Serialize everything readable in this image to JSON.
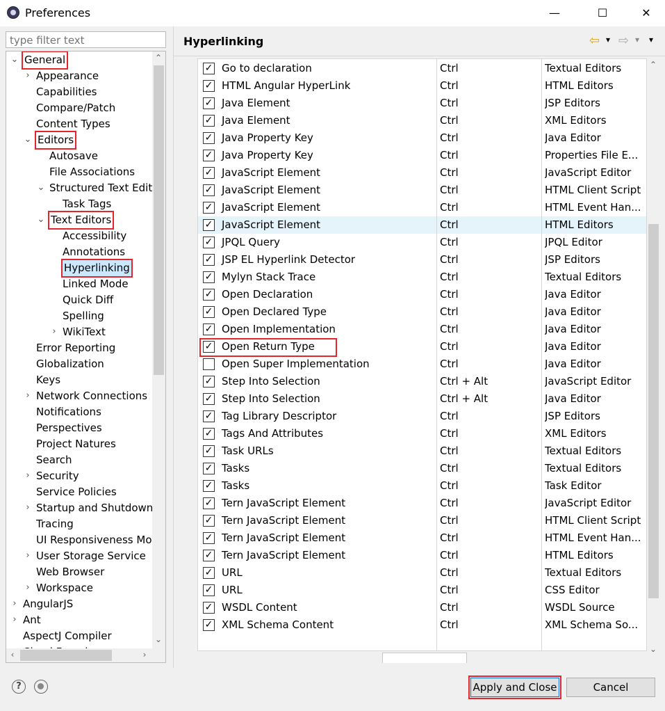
{
  "window": {
    "title": "Preferences",
    "minimize": "—",
    "maximize": "☐",
    "close": "✕"
  },
  "filter": {
    "placeholder": "type filter text"
  },
  "tree": [
    {
      "label": "General",
      "level": 0,
      "twisty": "open",
      "highlight": true
    },
    {
      "label": "Appearance",
      "level": 1,
      "twisty": "closed"
    },
    {
      "label": "Capabilities",
      "level": 1
    },
    {
      "label": "Compare/Patch",
      "level": 1
    },
    {
      "label": "Content Types",
      "level": 1
    },
    {
      "label": "Editors",
      "level": 1,
      "twisty": "open",
      "highlight": true
    },
    {
      "label": "Autosave",
      "level": 2
    },
    {
      "label": "File Associations",
      "level": 2
    },
    {
      "label": "Structured Text Editors",
      "level": 2,
      "twisty": "open"
    },
    {
      "label": "Task Tags",
      "level": 3
    },
    {
      "label": "Text Editors",
      "level": 2,
      "twisty": "open",
      "highlight": true
    },
    {
      "label": "Accessibility",
      "level": 3
    },
    {
      "label": "Annotations",
      "level": 3
    },
    {
      "label": "Hyperlinking",
      "level": 3,
      "highlight": true,
      "selected": true
    },
    {
      "label": "Linked Mode",
      "level": 3
    },
    {
      "label": "Quick Diff",
      "level": 3
    },
    {
      "label": "Spelling",
      "level": 3
    },
    {
      "label": "WikiText",
      "level": 3,
      "twisty": "closed"
    },
    {
      "label": "Error Reporting",
      "level": 1
    },
    {
      "label": "Globalization",
      "level": 1
    },
    {
      "label": "Keys",
      "level": 1
    },
    {
      "label": "Network Connections",
      "level": 1,
      "twisty": "closed"
    },
    {
      "label": "Notifications",
      "level": 1
    },
    {
      "label": "Perspectives",
      "level": 1
    },
    {
      "label": "Project Natures",
      "level": 1
    },
    {
      "label": "Search",
      "level": 1
    },
    {
      "label": "Security",
      "level": 1,
      "twisty": "closed"
    },
    {
      "label": "Service Policies",
      "level": 1
    },
    {
      "label": "Startup and Shutdown",
      "level": 1,
      "twisty": "closed"
    },
    {
      "label": "Tracing",
      "level": 1
    },
    {
      "label": "UI Responsiveness Monitoring",
      "level": 1
    },
    {
      "label": "User Storage Service",
      "level": 1,
      "twisty": "closed"
    },
    {
      "label": "Web Browser",
      "level": 1
    },
    {
      "label": "Workspace",
      "level": 1,
      "twisty": "closed"
    },
    {
      "label": "AngularJS",
      "level": 0,
      "twisty": "closed"
    },
    {
      "label": "Ant",
      "level": 0,
      "twisty": "closed"
    },
    {
      "label": "AspectJ Compiler",
      "level": 0
    },
    {
      "label": "Cloud Foundry",
      "level": 0,
      "twisty": "closed"
    }
  ],
  "page": {
    "title": "Hyperlinking"
  },
  "detectors": [
    {
      "name": "Go to declaration",
      "modifier": "Ctrl",
      "target": "Textual Editors",
      "checked": true
    },
    {
      "name": "HTML Angular HyperLink",
      "modifier": "Ctrl",
      "target": "HTML Editors",
      "checked": true
    },
    {
      "name": "Java Element",
      "modifier": "Ctrl",
      "target": "JSP Editors",
      "checked": true
    },
    {
      "name": "Java Element",
      "modifier": "Ctrl",
      "target": "XML Editors",
      "checked": true
    },
    {
      "name": "Java Property Key",
      "modifier": "Ctrl",
      "target": "Java Editor",
      "checked": true
    },
    {
      "name": "Java Property Key",
      "modifier": "Ctrl",
      "target": "Properties File E...",
      "checked": true
    },
    {
      "name": "JavaScript Element",
      "modifier": "Ctrl",
      "target": "JavaScript Editor",
      "checked": true
    },
    {
      "name": "JavaScript Element",
      "modifier": "Ctrl",
      "target": "HTML Client Script",
      "checked": true
    },
    {
      "name": "JavaScript Element",
      "modifier": "Ctrl",
      "target": "HTML Event Han...",
      "checked": true
    },
    {
      "name": "JavaScript Element",
      "modifier": "Ctrl",
      "target": "HTML Editors",
      "checked": true,
      "hover": true
    },
    {
      "name": "JPQL Query",
      "modifier": "Ctrl",
      "target": "JPQL Editor",
      "checked": true
    },
    {
      "name": "JSP EL Hyperlink Detector",
      "modifier": "Ctrl",
      "target": "JSP Editors",
      "checked": true
    },
    {
      "name": "Mylyn Stack Trace",
      "modifier": "Ctrl",
      "target": "Textual Editors",
      "checked": true
    },
    {
      "name": "Open Declaration",
      "modifier": "Ctrl",
      "target": "Java Editor",
      "checked": true
    },
    {
      "name": "Open Declared Type",
      "modifier": "Ctrl",
      "target": "Java Editor",
      "checked": true
    },
    {
      "name": "Open Implementation",
      "modifier": "Ctrl",
      "target": "Java Editor",
      "checked": true
    },
    {
      "name": "Open Return Type",
      "modifier": "Ctrl",
      "target": "Java Editor",
      "checked": true,
      "highlight": true
    },
    {
      "name": "Open Super Implementation",
      "modifier": "Ctrl",
      "target": "Java Editor",
      "checked": false
    },
    {
      "name": "Step Into Selection",
      "modifier": "Ctrl + Alt",
      "target": "JavaScript Editor",
      "checked": true
    },
    {
      "name": "Step Into Selection",
      "modifier": "Ctrl + Alt",
      "target": "Java Editor",
      "checked": true
    },
    {
      "name": "Tag Library Descriptor",
      "modifier": "Ctrl",
      "target": "JSP Editors",
      "checked": true
    },
    {
      "name": "Tags And Attributes",
      "modifier": "Ctrl",
      "target": "XML Editors",
      "checked": true
    },
    {
      "name": "Task URLs",
      "modifier": "Ctrl",
      "target": "Textual Editors",
      "checked": true
    },
    {
      "name": "Tasks",
      "modifier": "Ctrl",
      "target": "Textual Editors",
      "checked": true
    },
    {
      "name": "Tasks",
      "modifier": "Ctrl",
      "target": "Task Editor",
      "checked": true
    },
    {
      "name": "Tern JavaScript Element",
      "modifier": "Ctrl",
      "target": "JavaScript Editor",
      "checked": true
    },
    {
      "name": "Tern JavaScript Element",
      "modifier": "Ctrl",
      "target": "HTML Client Script",
      "checked": true
    },
    {
      "name": "Tern JavaScript Element",
      "modifier": "Ctrl",
      "target": "HTML Event Han...",
      "checked": true
    },
    {
      "name": "Tern JavaScript Element",
      "modifier": "Ctrl",
      "target": "HTML Editors",
      "checked": true
    },
    {
      "name": "URL",
      "modifier": "Ctrl",
      "target": "Textual Editors",
      "checked": true
    },
    {
      "name": "URL",
      "modifier": "Ctrl",
      "target": "CSS Editor",
      "checked": true
    },
    {
      "name": "WSDL Content",
      "modifier": "Ctrl",
      "target": "WSDL Source",
      "checked": true
    },
    {
      "name": "XML Schema Content",
      "modifier": "Ctrl",
      "target": "XML Schema So...",
      "checked": true
    }
  ],
  "buttons": {
    "apply_close": "Apply and Close",
    "cancel": "Cancel",
    "help": "?"
  },
  "colors": {
    "highlight": "#e3262e",
    "selection": "#cce8ff",
    "hover": "#e5f3fb",
    "nav_back": "#d9a520"
  },
  "icons": {
    "check": "✓",
    "back": "⇦",
    "forward": "⇨",
    "dropdown": "▾",
    "tree_open": "⌄",
    "tree_closed": "›",
    "scroll_up": "⌃",
    "scroll_down": "⌄",
    "scroll_left": "‹",
    "scroll_right": "›"
  }
}
